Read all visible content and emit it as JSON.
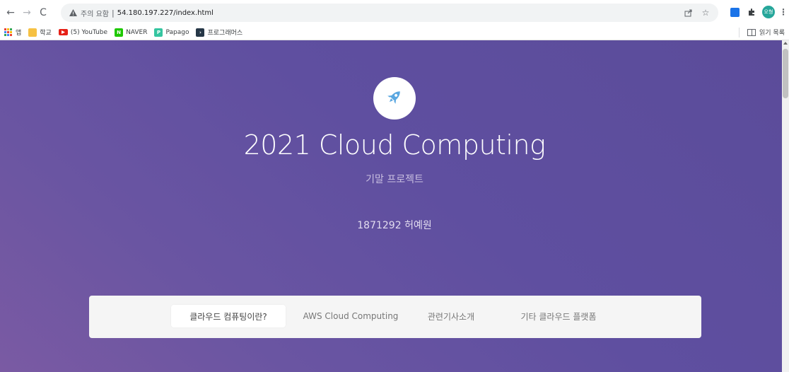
{
  "browser": {
    "back_label": "←",
    "forward_label": "→",
    "reload_label": "C",
    "security_label": "주의 요함",
    "separator": "|",
    "url": "54.180.197.227/index.html",
    "profile_label": "오형"
  },
  "bookmarks": {
    "items": [
      {
        "label": "앱",
        "icon": "apps-grid-icon"
      },
      {
        "label": "학교",
        "icon": "folder-icon"
      },
      {
        "label": "(5) YouTube",
        "icon": "youtube-icon"
      },
      {
        "label": "NAVER",
        "icon": "naver-icon"
      },
      {
        "label": "Papago",
        "icon": "papago-icon"
      },
      {
        "label": "프로그래머스",
        "icon": "programmers-icon"
      }
    ],
    "reading_list": "읽기 목록"
  },
  "hero": {
    "title": "2021 Cloud Computing",
    "subtitle": "기말 프로젝트",
    "author": "1871292 허예원",
    "logo_icon": "rocket-icon"
  },
  "nav": {
    "tabs": [
      {
        "label": "클라우드 컴퓨팅이란?",
        "active": true
      },
      {
        "label": "AWS Cloud Computing",
        "active": false
      },
      {
        "label": "관련기사소개",
        "active": false
      },
      {
        "label": "기타 클라우드 플랫폼",
        "active": false
      }
    ]
  },
  "colors": {
    "gradient_start": "#7a5aa3",
    "gradient_end": "#5b4c9a",
    "rocket": "#5aa7e0",
    "nav_panel": "#f5f5f5"
  }
}
